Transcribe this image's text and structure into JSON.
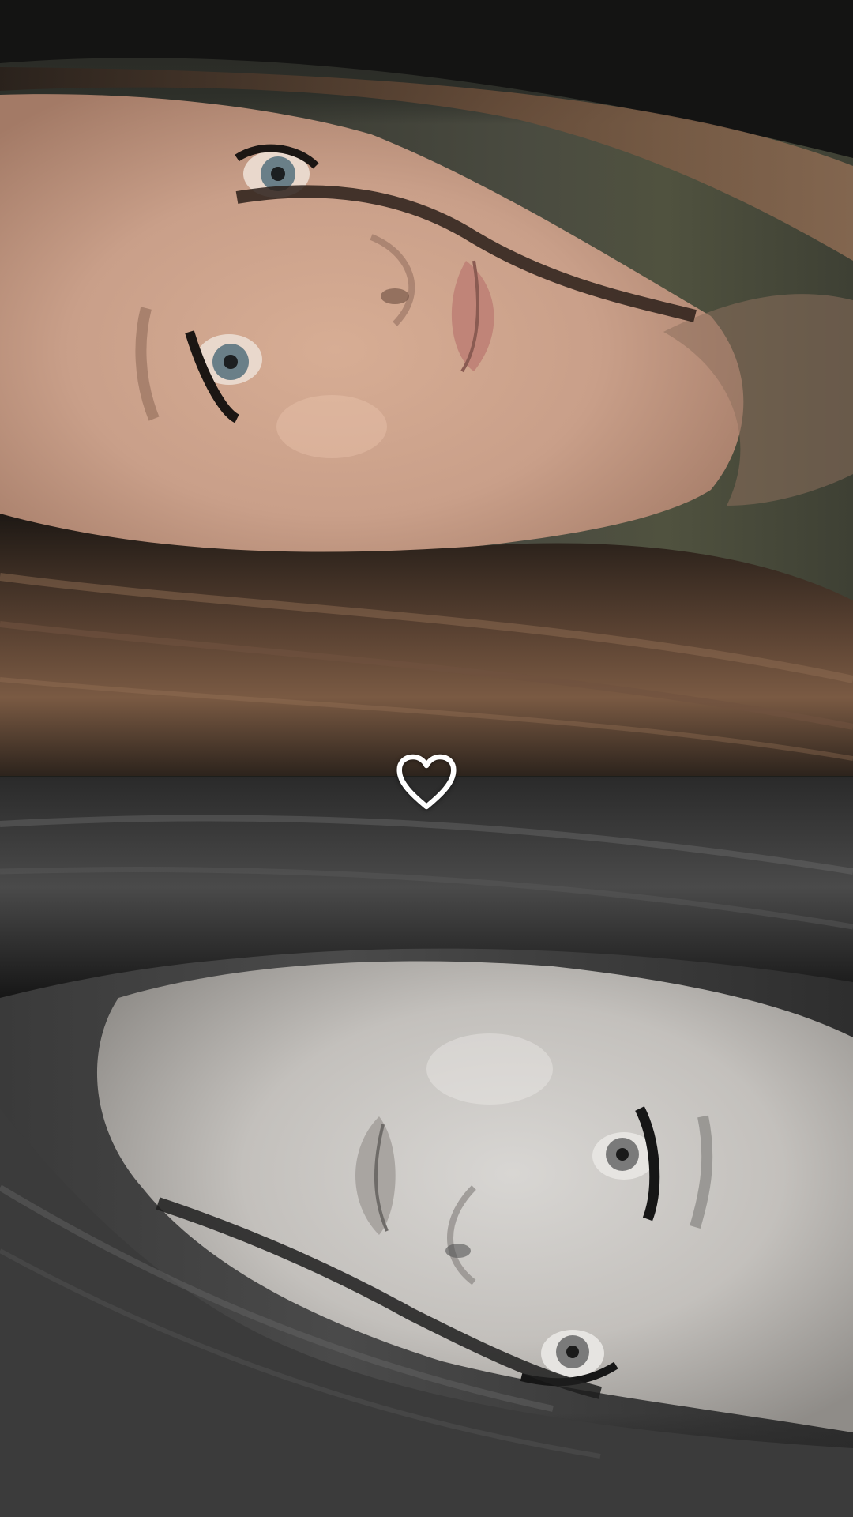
{
  "photos": {
    "top": {
      "icon": "photo-color",
      "tint": "#c49a84"
    },
    "bottom": {
      "icon": "photo-grayscale",
      "tint": "#b9b9b9"
    }
  },
  "like_button": {
    "icon": "heart-outline-icon",
    "color": "#ffffff",
    "liked": false
  }
}
